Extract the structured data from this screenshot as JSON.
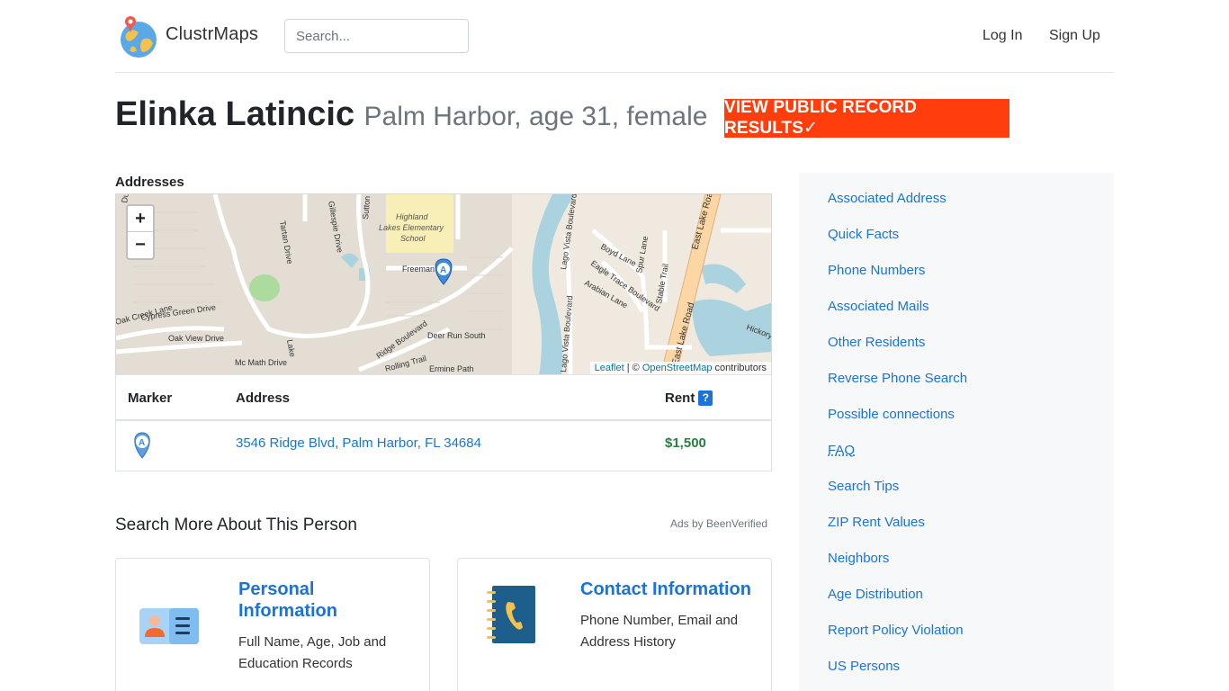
{
  "header": {
    "brand": "ClustrMaps",
    "search_placeholder": "Search...",
    "login": "Log In",
    "signup": "Sign Up"
  },
  "person": {
    "name": "Elinka Latincic",
    "subtitle": "Palm Harbor, age 31, female",
    "cta": "VIEW PUBLIC RECORD RESULTS✓"
  },
  "addresses": {
    "label": "Addresses",
    "map": {
      "zoom_in": "+",
      "zoom_out": "−",
      "attribution_leaflet": "Leaflet",
      "attribution_sep": " | © ",
      "attribution_osm": "OpenStreetMap",
      "attribution_suffix": " contributors",
      "labels": {
        "school": [
          "Highland",
          "Lakes Elementary",
          "School"
        ],
        "freeman": "Freeman",
        "boyd": "Boyd Lane",
        "eagle_trace": "Eagle Trace Boulevard",
        "arabian": "Arabian Lane",
        "spur": "Spur Lane",
        "stable": "Stable Trail",
        "east_lake_road_1": "East Lake Road",
        "east_lake_road_2": "East Lake Road",
        "lago_vista_1": "Lago Vista Boulevard",
        "lago_vista_2": "Lago Vista Boulevard",
        "cypress": "Cypress Green Drive",
        "oak_view": "Oak View Drive",
        "oak_creek": "Oak Creek Lane",
        "tartan": "Tartan Drive",
        "sutton": "Sutton Place",
        "gillespie": "Gillespie Drive",
        "deer_run": "Deer Run South",
        "ridge_blvd": "Ridge Boulevard",
        "rolling": "Rolling Trail",
        "mc_math": "Mc Math Drive",
        "ermine": "Ermine Path",
        "hickory": "Hickory",
        "lake": "Lake",
        "dunde": "Dunde",
        "marker_letter": "A"
      }
    },
    "table": {
      "col_marker": "Marker",
      "col_address": "Address",
      "col_rent": "Rent",
      "help": "?",
      "rows": [
        {
          "marker": "A",
          "address": "3546 Ridge Blvd, Palm Harbor, FL 34684",
          "rent": "$1,500"
        }
      ]
    }
  },
  "search_more": {
    "title": "Search More About This Person",
    "ads": "Ads by BeenVerified",
    "cards": [
      {
        "title": "Personal Information",
        "desc": "Full Name, Age, Job and Education Records",
        "icon": "id-card-icon"
      },
      {
        "title": "Contact Information",
        "desc": "Phone Number, Email and Address History",
        "icon": "phone-book-icon"
      }
    ]
  },
  "sidebar": {
    "items": [
      "Associated Address",
      "Quick Facts",
      "Phone Numbers",
      "Associated Mails",
      "Other Residents",
      "Reverse Phone Search",
      "Possible connections",
      "FAQ",
      "Search Tips",
      "ZIP Rent Values",
      "Neighbors",
      "Age Distribution",
      "Report Policy Violation",
      "US Persons"
    ]
  },
  "colors": {
    "link": "#1a73d9",
    "cta": "#ff3d0d",
    "rent": "#28803e",
    "sidebar_bg": "#f7f8fa"
  }
}
